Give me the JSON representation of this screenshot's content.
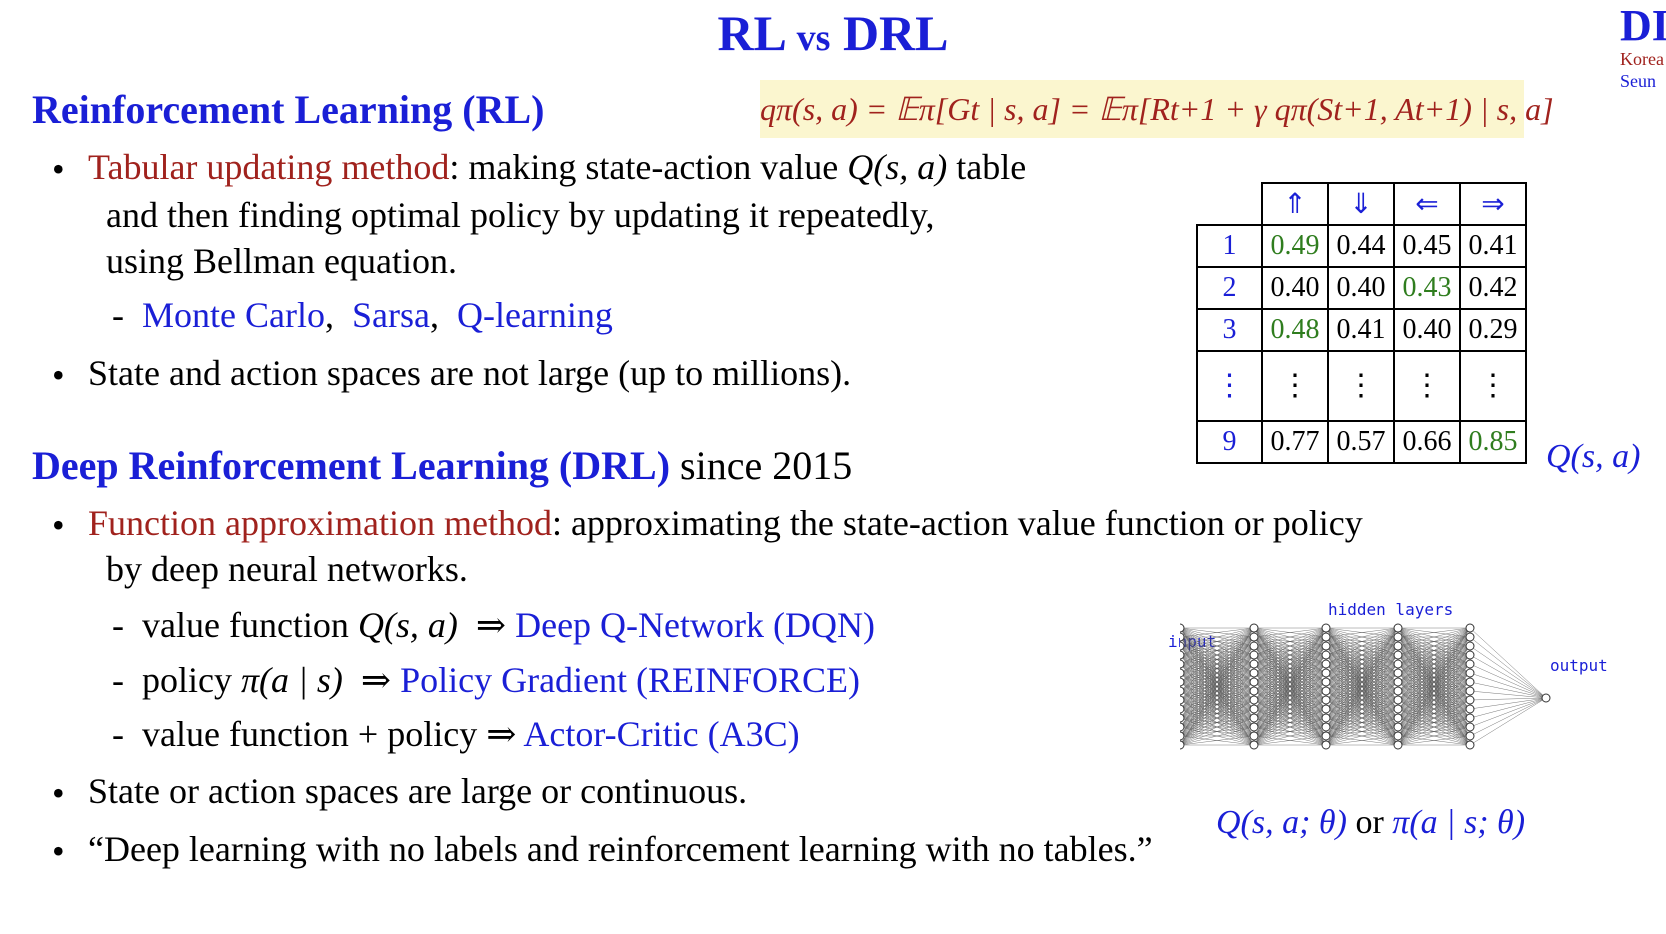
{
  "title": {
    "rl": "RL",
    "vs": "vs",
    "drl": "DRL"
  },
  "logo": {
    "big": "DI",
    "line1": "Korea",
    "line2": "Seun"
  },
  "rl_section": {
    "heading": "Reinforcement Learning (RL)",
    "formula": "qπ(s, a) = 𝔼π[Gt | s, a] = 𝔼π[Rt+1 + γ qπ(St+1, At+1) | s, a]",
    "bullet1": {
      "term": "Tabular updating method",
      "text_a": ": making state-action value ",
      "q": "Q(s, a)",
      "text_b": " table",
      "line2": "and then finding optimal policy by updating it repeatedly,",
      "line3": "using Bellman equation."
    },
    "methods": {
      "dash": "-",
      "m1": "Monte Carlo",
      "sep1": ",",
      "m2": "Sarsa",
      "sep2": ",",
      "m3": "Q-learning"
    },
    "bullet2": "State and action spaces are not large (up to millions)."
  },
  "q_table": {
    "headers": [
      "⇑",
      "⇓",
      "⇐",
      "⇒"
    ],
    "rows": [
      {
        "id": "1",
        "values": [
          "0.49",
          "0.44",
          "0.45",
          "0.41"
        ],
        "highlight": 0
      },
      {
        "id": "2",
        "values": [
          "0.40",
          "0.40",
          "0.43",
          "0.42"
        ],
        "highlight": 2
      },
      {
        "id": "3",
        "values": [
          "0.48",
          "0.41",
          "0.40",
          "0.29"
        ],
        "highlight": 0
      },
      {
        "id": "⋮",
        "values": [
          "⋮",
          "⋮",
          "⋮",
          "⋮"
        ],
        "highlight": -1
      },
      {
        "id": "9",
        "values": [
          "0.77",
          "0.57",
          "0.66",
          "0.85"
        ],
        "highlight": 3
      }
    ],
    "label": "Q(s, a)",
    "highlight_color": "#2f7d1e"
  },
  "drl_section": {
    "heading": "Deep Reinforcement Learning (DRL)",
    "since": "since 2015",
    "bullet1": {
      "term": "Function approximation method",
      "text": ": approximating the state-action value function or policy",
      "line2": "by deep neural networks."
    },
    "items": [
      {
        "dash": "-",
        "pre": "value function ",
        "math": "Q(s, a)",
        "arrow": "⇒",
        "result": "Deep Q-Network (DQN)"
      },
      {
        "dash": "-",
        "pre": "policy ",
        "math": "π(a | s)",
        "arrow": "⇒",
        "result": "Policy Gradient (REINFORCE)"
      },
      {
        "dash": "-",
        "pre": "value function + policy ",
        "math": "",
        "arrow": "⇒",
        "result": "Actor-Critic (A3C)"
      }
    ],
    "bullet2": "State or action spaces are large or continuous.",
    "bullet3": "“Deep learning with no labels and reinforcement learning with no tables.”"
  },
  "network": {
    "input_label": "input",
    "hidden_label": "hidden layers",
    "output_label": "output",
    "caption_a": "Q(s, a; θ)",
    "caption_or": "or",
    "caption_b": "π(a | s; θ)"
  },
  "colors": {
    "accent_blue": "#1a1fd6",
    "term_red": "#a0221d",
    "value_green": "#2f7d1e",
    "formula_bg": "#fbf6cf"
  }
}
